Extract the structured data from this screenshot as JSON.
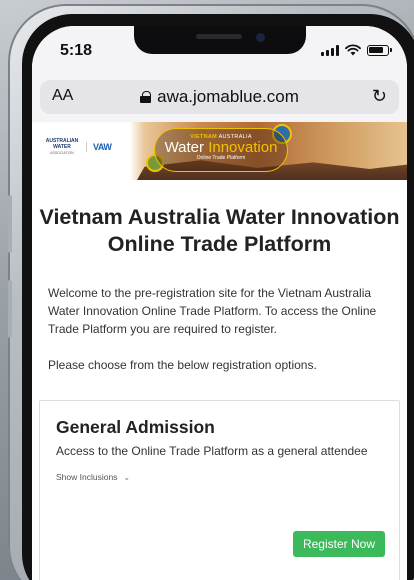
{
  "status": {
    "time": "5:18"
  },
  "browser": {
    "text_size_label": "AA",
    "url": "awa.jomablue.com"
  },
  "banner": {
    "logo_left_line1": "AUSTRALIAN",
    "logo_left_line2": "WATER",
    "logo_left_sub": "ASSOCIATION",
    "logo_right": "VAW",
    "badge_kicker_country": "VIETNAM",
    "badge_kicker_rest": "AUSTRALIA",
    "badge_title_a": "Water",
    "badge_title_b": "Innovation",
    "badge_sub": "Online Trade Platform"
  },
  "page": {
    "title": "Vietnam Australia Water Innovation Online Trade Platform",
    "intro": "Welcome to the pre-registration site for the Vietnam Australia Water Innovation Online Trade Platform. To access the Online Trade Platform you are required to register.",
    "choose": "Please choose from the below registration options."
  },
  "option": {
    "title": "General Admission",
    "description": "Access to the Online Trade Platform as a general attendee",
    "inclusions_label": "Show Inclusions",
    "button_label": "Register Now",
    "button_color": "#3cb95a"
  }
}
